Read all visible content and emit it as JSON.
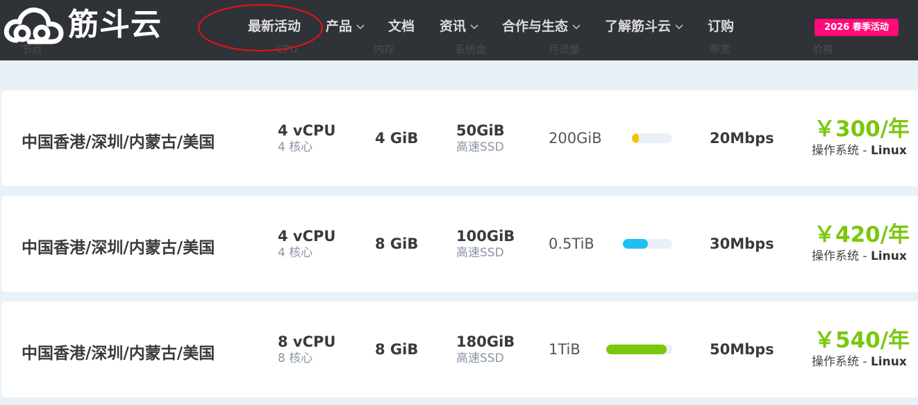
{
  "brand": {
    "name": "筋斗云",
    "logo_icon": "cloud-icon"
  },
  "nav": {
    "items": [
      {
        "label": "最新活动",
        "has_dropdown": false
      },
      {
        "label": "产品",
        "has_dropdown": true
      },
      {
        "label": "文档",
        "has_dropdown": false
      },
      {
        "label": "资讯",
        "has_dropdown": true
      },
      {
        "label": "合作与生态",
        "has_dropdown": true
      },
      {
        "label": "了解筋斗云",
        "has_dropdown": true
      },
      {
        "label": "订购",
        "has_dropdown": false
      }
    ],
    "promo_badge": "2026 春季活动"
  },
  "table_headers": [
    "节点",
    "CPU",
    "内存",
    "系统盘",
    "月流量",
    "带宽",
    "价格"
  ],
  "plans": [
    {
      "region": "中国香港/深圳/内蒙古/美国",
      "cpu": "4 vCPU",
      "cpu_cores": "4 核心",
      "memory": "4 GiB",
      "disk": "50GiB",
      "disk_type": "高速SSD",
      "traffic": "200GiB",
      "traffic_level": 0.18,
      "traffic_color": "#f5c400",
      "bandwidth": "20Mbps",
      "price": "￥300/年",
      "os_label": "操作系统 - ",
      "os_value": "Linux"
    },
    {
      "region": "中国香港/深圳/内蒙古/美国",
      "cpu": "4 vCPU",
      "cpu_cores": "4 核心",
      "memory": "8 GiB",
      "disk": "100GiB",
      "disk_type": "高速SSD",
      "traffic": "0.5TiB",
      "traffic_level": 0.5,
      "traffic_color": "#1ec0f0",
      "bandwidth": "30Mbps",
      "price": "￥420/年",
      "os_label": "操作系统 - ",
      "os_value": "Linux"
    },
    {
      "region": "中国香港/深圳/内蒙古/美国",
      "cpu": "8 vCPU",
      "cpu_cores": "8 核心",
      "memory": "8 GiB",
      "disk": "180GiB",
      "disk_type": "高速SSD",
      "traffic": "1TiB",
      "traffic_level": 0.92,
      "traffic_color": "#7ac70c",
      "bandwidth": "50Mbps",
      "price": "￥540/年",
      "os_label": "操作系统 - ",
      "os_value": "Linux"
    }
  ],
  "colors": {
    "navbar": "#2f3236",
    "accent_green": "#7ac70c",
    "promo": "#ff0a78",
    "annotation": "#d9141b"
  }
}
